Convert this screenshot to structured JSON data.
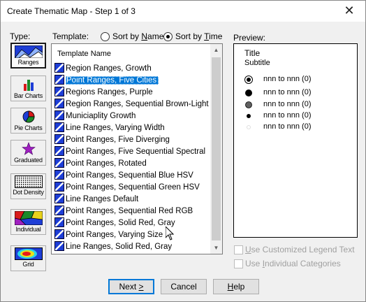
{
  "window": {
    "title": "Create Thematic Map - Step 1 of 3",
    "close_glyph": "✕"
  },
  "type_panel": {
    "label": "Type:",
    "buttons": [
      {
        "label": "Ranges",
        "icon": "ranges-icon",
        "selected": true
      },
      {
        "label": "Bar Charts",
        "icon": "bar-chart-icon",
        "selected": false
      },
      {
        "label": "Pie Charts",
        "icon": "pie-chart-icon",
        "selected": false
      },
      {
        "label": "Graduated",
        "icon": "graduated-star-icon",
        "selected": false
      },
      {
        "label": "Dot Density",
        "icon": "dot-density-icon",
        "selected": false
      },
      {
        "label": "Individual",
        "icon": "individual-icon",
        "selected": false
      },
      {
        "label": "Grid",
        "icon": "grid-heatmap-icon",
        "selected": false
      }
    ]
  },
  "template_panel": {
    "label": "Template:",
    "sort_by_name": {
      "label_prefix": "Sort by ",
      "label_accel": "N",
      "label_rest": "ame",
      "checked": false
    },
    "sort_by_time": {
      "label_prefix": "Sort by ",
      "label_accel": "T",
      "label_rest": "ime",
      "checked": true
    },
    "list_header": "Template Name",
    "items": [
      "Region Ranges, Growth",
      "Point Ranges, Five Cities",
      "Regions Ranges, Purple",
      "Region Ranges, Sequential Brown-Light Yel",
      "Municiaplity Growth",
      "Line Ranges, Varying Width",
      "Point Ranges, Five Diverging",
      "Point Ranges, Five Sequential Spectral",
      "Point Ranges, Rotated",
      "Point Ranges, Sequential Blue HSV",
      "Point Ranges, Sequential Green HSV",
      "Line Ranges Default",
      "Point Ranges, Sequential Red RGB",
      "Point Ranges, Solid Red, Gray",
      "Point Ranges, Varying Size",
      "Line Ranges, Solid Red, Gray"
    ],
    "selected_index": 1
  },
  "preview_panel": {
    "label": "Preview:",
    "title": "Title",
    "subtitle": "Subtitle",
    "legend_rows": [
      {
        "text": "nnn to nnn  (0)",
        "symbol": "circle-ring-large"
      },
      {
        "text": "nnn to nnn  (0)",
        "symbol": "circle-solid-large"
      },
      {
        "text": "nnn to nnn  (0)",
        "symbol": "circle-gray-large"
      },
      {
        "text": "nnn to nnn  (0)",
        "symbol": "circle-solid-small"
      },
      {
        "text": "nnn to nnn  (0)",
        "symbol": "circle-faint-small"
      }
    ]
  },
  "options": {
    "use_customized_legend_text": {
      "label_accel": "U",
      "label_rest": "se Customized Legend Text",
      "checked": false,
      "enabled": false
    },
    "use_individual_categories": {
      "label_prefix": "Use ",
      "label_accel": "I",
      "label_rest": "ndividual Categories",
      "checked": false,
      "enabled": false
    }
  },
  "buttons": {
    "next": {
      "prefix": "Next ",
      "accel": ">",
      "suffix": ""
    },
    "cancel": "Cancel",
    "help": {
      "prefix": "",
      "accel": "H",
      "suffix": "elp"
    }
  },
  "colors": {
    "selection": "#0078d7",
    "template_icon_blue": "#1e3ed6",
    "default_button_border": "#0078d7"
  }
}
